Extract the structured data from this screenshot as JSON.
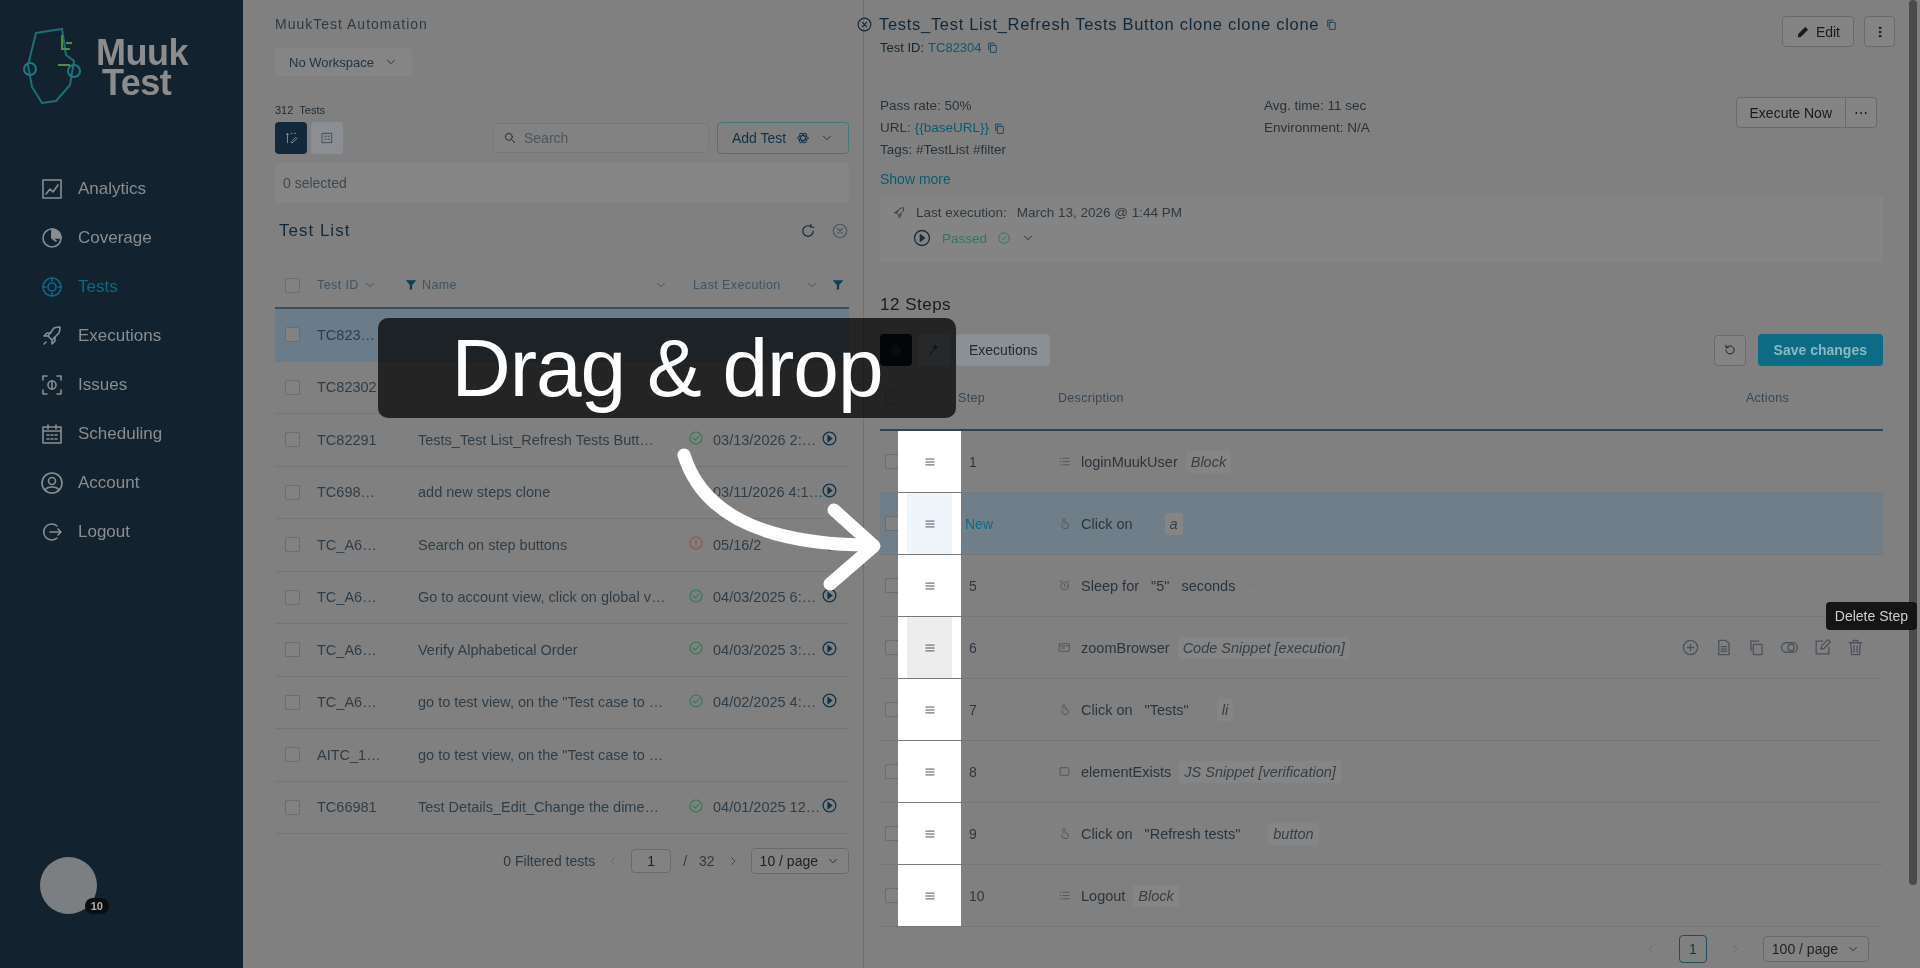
{
  "sidebar": {
    "logo": {
      "line1": "Muuk",
      "line2": "Test"
    },
    "items": [
      {
        "label": "Analytics",
        "selected": false
      },
      {
        "label": "Coverage",
        "selected": false
      },
      {
        "label": "Tests",
        "selected": true
      },
      {
        "label": "Executions",
        "selected": false
      },
      {
        "label": "Issues",
        "selected": false
      },
      {
        "label": "Scheduling",
        "selected": false
      },
      {
        "label": "Account",
        "selected": false
      },
      {
        "label": "Logout",
        "selected": false
      }
    ],
    "avatar": {
      "badge": "10"
    }
  },
  "tests_pane": {
    "account": "MuukTest Automation",
    "workspace": "No Workspace",
    "count": "312",
    "count_label": "Tests",
    "view_toggle": [
      {
        "selected": true
      },
      {
        "selected": false
      }
    ],
    "search": {
      "placeholder": "Search"
    },
    "add_button": "Add Test",
    "selection": "0 selected",
    "list_title": "Test List",
    "all_checked": false,
    "columns": [
      "Test ID",
      "Name",
      "Last Execution"
    ],
    "rows": [
      {
        "id": "TC823…",
        "checked": false,
        "selected": true
      },
      {
        "id": "TC82302",
        "checked": false,
        "selected": false
      },
      {
        "id": "TC82291",
        "name": "Tests_Test List_Refresh Tests Butt…",
        "passed": true,
        "date": "03/13/2026 2:…",
        "checked": false,
        "selected": false
      },
      {
        "id": "TC698…",
        "name": "add new steps clone",
        "date": "03/11/2026 4:1…",
        "checked": false,
        "selected": false
      },
      {
        "id": "TC_A6…",
        "name": "Search on step buttons",
        "passed": false,
        "date": "05/16/2",
        "checked": false,
        "selected": false
      },
      {
        "id": "TC_A6…",
        "name": "Go to account view, click on global v…",
        "passed": true,
        "date": "04/03/2025 6:…",
        "checked": false,
        "selected": false
      },
      {
        "id": "TC_A6…",
        "name": "Verify Alphabetical Order",
        "passed": true,
        "date": "04/03/2025 3:…",
        "checked": false,
        "selected": false
      },
      {
        "id": "TC_A6…",
        "name": "go to test view, on the \"Test case to …",
        "passed": true,
        "date": "04/02/2025 4:…",
        "checked": false,
        "selected": false
      },
      {
        "id": "AITC_1…",
        "name": "go to test view, on the \"Test case to …",
        "checked": false,
        "selected": false
      },
      {
        "id": "TC66981",
        "name": "Test Details_Edit_Change the dime…",
        "passed": true,
        "date": "04/01/2025 12…",
        "checked": false,
        "selected": false
      }
    ],
    "pagination": {
      "summary": "0 Filtered tests",
      "page": "1",
      "separator": "/",
      "total": "32",
      "page_size": "10 / page"
    }
  },
  "detail": {
    "title": "Tests_Test List_Refresh Tests Button clone clone clone",
    "test_id_label": "Test ID:",
    "test_id": "TC82304",
    "edit_button": "Edit",
    "info_left": [
      {
        "kind": "text",
        "text": "Pass rate: 50%"
      },
      {
        "kind": "url",
        "label": "URL:",
        "value": "{{baseURL}}"
      },
      {
        "kind": "text",
        "text": "Tags: #TestList #filter"
      }
    ],
    "info_right": [
      "Avg. time: 11 sec",
      "Environment: N/A"
    ],
    "execute_button": "Execute Now",
    "more_button": "⋯",
    "show_more": "Show more",
    "last_execution": {
      "label": "Last execution:",
      "date": "March 13, 2026 @ 1:44 PM",
      "status": "Passed"
    }
  },
  "steps": {
    "heading": "12 Steps",
    "tabs": [
      {
        "kind": "settings",
        "selected": true
      },
      {
        "kind": "magic",
        "selected": false
      },
      {
        "kind": "label",
        "label": "Executions",
        "selected": false
      }
    ],
    "save_button": "Save changes",
    "all_checked": false,
    "columns": [
      "Step",
      "Description",
      "Actions"
    ],
    "rows": [
      {
        "step": "1",
        "kind": "block",
        "text": "loginMuukUser",
        "tag": "Block",
        "checked": false,
        "is_new": false,
        "hovered": false
      },
      {
        "step": "New",
        "kind": "click",
        "text": "Click on",
        "tag": "a",
        "checked": false,
        "is_new": true,
        "hovered": false
      },
      {
        "step": "5",
        "kind": "sleep",
        "text": "Sleep for",
        "target": "\"5\"",
        "suffix": "seconds",
        "checked": false,
        "is_new": false,
        "hovered": false
      },
      {
        "step": "6",
        "kind": "code",
        "text": "zoomBrowser",
        "tag": "Code Snippet [execution]",
        "checked": false,
        "is_new": false,
        "hovered": true,
        "tooltip": "Delete Step"
      },
      {
        "step": "7",
        "kind": "click",
        "text": "Click on",
        "target": "\"Tests\"",
        "tag": "li",
        "checked": false,
        "is_new": false,
        "hovered": false
      },
      {
        "step": "8",
        "kind": "check",
        "text": "elementExists",
        "tag": "JS Snippet [verification]",
        "checked": false,
        "is_new": false,
        "hovered": false
      },
      {
        "step": "9",
        "kind": "click",
        "text": "Click on",
        "target": "\"Refresh tests\"",
        "tag": "button",
        "checked": false,
        "is_new": false,
        "hovered": false
      },
      {
        "step": "10",
        "kind": "block",
        "text": "Logout",
        "tag": "Block",
        "checked": false,
        "is_new": false,
        "hovered": false
      }
    ],
    "pagination": {
      "page": "1",
      "page_size": "100 / page"
    }
  },
  "overlay": {
    "callout": "Drag & drop"
  }
}
